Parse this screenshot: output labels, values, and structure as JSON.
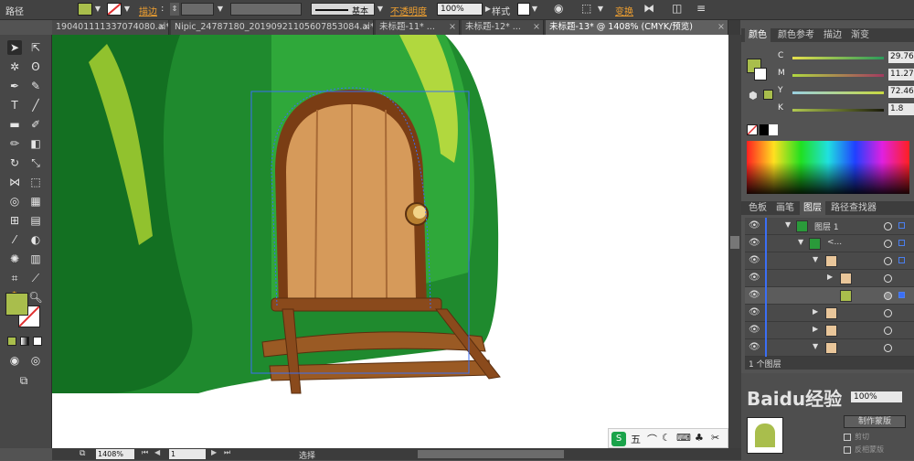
{
  "control_bar": {
    "object_label": "路径",
    "fill_color": "#a9be4c",
    "stroke_label": "描边",
    "stroke_style": "基本",
    "opacity_label": "不透明度",
    "opacity_value": "100%",
    "style_label": "样式",
    "transform_label": "变换"
  },
  "tabs": [
    {
      "label": "1904011113370740​80.ai* @ ...",
      "close": "×"
    },
    {
      "label": "Nipic_24787180_20190921105607853084.ai* @...",
      "close": "×"
    },
    {
      "label": "未标题-11* ...",
      "close": "×"
    },
    {
      "label": "未标题-12* ...",
      "close": "×"
    },
    {
      "label": "未标题-13* @ 1408% (CMYK/预览)",
      "close": "×"
    }
  ],
  "tools": {
    "fill_color": "#a9be4c",
    "stroke_color": "#ffffff"
  },
  "status": {
    "zoom": "1408%",
    "page": "1",
    "mode": "选择"
  },
  "color_panel": {
    "tabs": [
      "颜色",
      "颜色参考",
      "描边",
      "渐变"
    ],
    "channels": [
      {
        "name": "C",
        "value": "29.76"
      },
      {
        "name": "M",
        "value": "11.27"
      },
      {
        "name": "Y",
        "value": "72.46"
      },
      {
        "name": "K",
        "value": "1.8"
      }
    ],
    "current_color": "#a9be4c"
  },
  "layers_panel": {
    "tabs": [
      "色板",
      "画笔",
      "图层",
      "路径查找器"
    ],
    "layers": [
      {
        "name": "图层 1",
        "depth": 0
      },
      {
        "name": "<...",
        "depth": 1
      }
    ],
    "footer": "1 个图层"
  },
  "transparency_panel": {
    "opacity": "100%",
    "make_mask": "制作蒙版",
    "clip_label": "剪切",
    "invert_label": "反相蒙版"
  },
  "ime_bar": {
    "label": "五"
  },
  "watermark": "Baidu经验"
}
